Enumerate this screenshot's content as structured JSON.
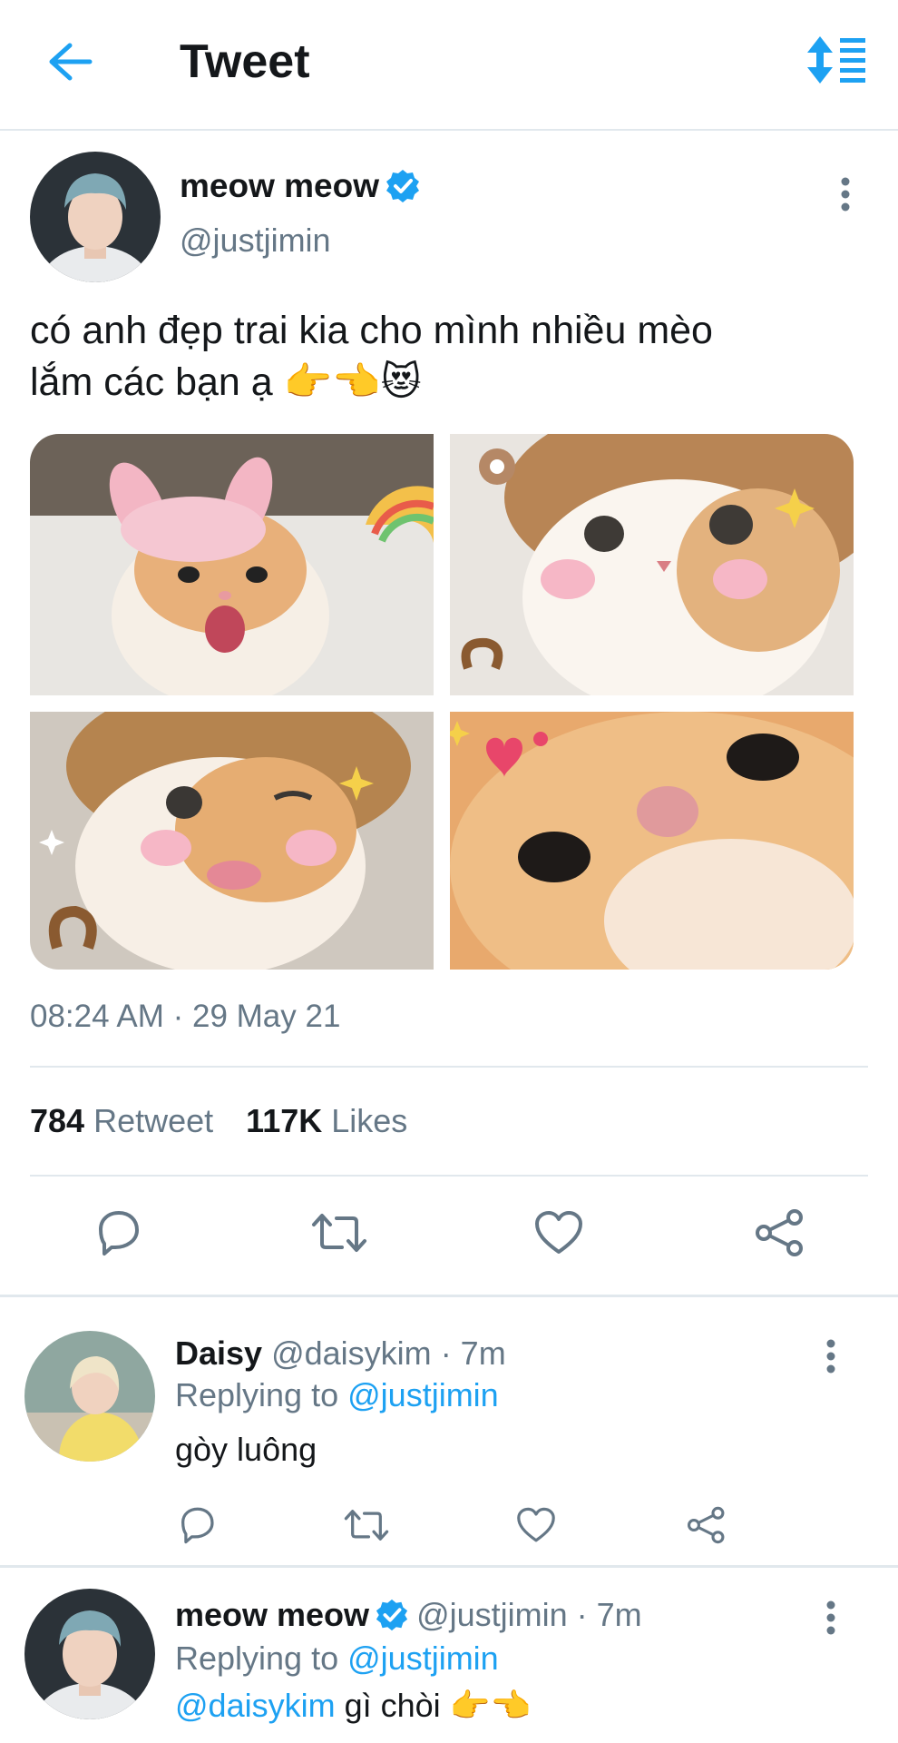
{
  "header": {
    "title": "Tweet",
    "back_icon": "arrow-left-icon",
    "sort_icon": "sort-replies-icon",
    "accent": "#1da1f2"
  },
  "tweet": {
    "display_name": "meow meow",
    "handle": "@justjimin",
    "verified_icon": "verified-badge-icon",
    "text_line1": "có anh đẹp trai kia cho mình nhiều mèo",
    "text_line2": "lắm các bạn ạ 👉👈😻",
    "media_count": 4,
    "timestamp": "08:24 AM · 29 May 21",
    "retweets": "784",
    "retweets_label": "Retweet",
    "likes": "117K",
    "likes_label": "Likes"
  },
  "actions": [
    "reply-icon",
    "retweet-icon",
    "like-icon",
    "share-icon"
  ],
  "replies": [
    {
      "display_name": "Daisy",
      "handle": "@daisykim",
      "time": "· 7m",
      "replying_label": "Replying to",
      "replying_to": "@justjimin",
      "text": "gòy luông",
      "verified": false
    },
    {
      "display_name": "meow meow",
      "handle": "@justjimin",
      "time": "· 7m",
      "replying_label": "Replying to",
      "replying_to": "@justjimin",
      "mention": "@daisykim",
      "text": " gì chòi 👉👈",
      "verified": true
    }
  ]
}
